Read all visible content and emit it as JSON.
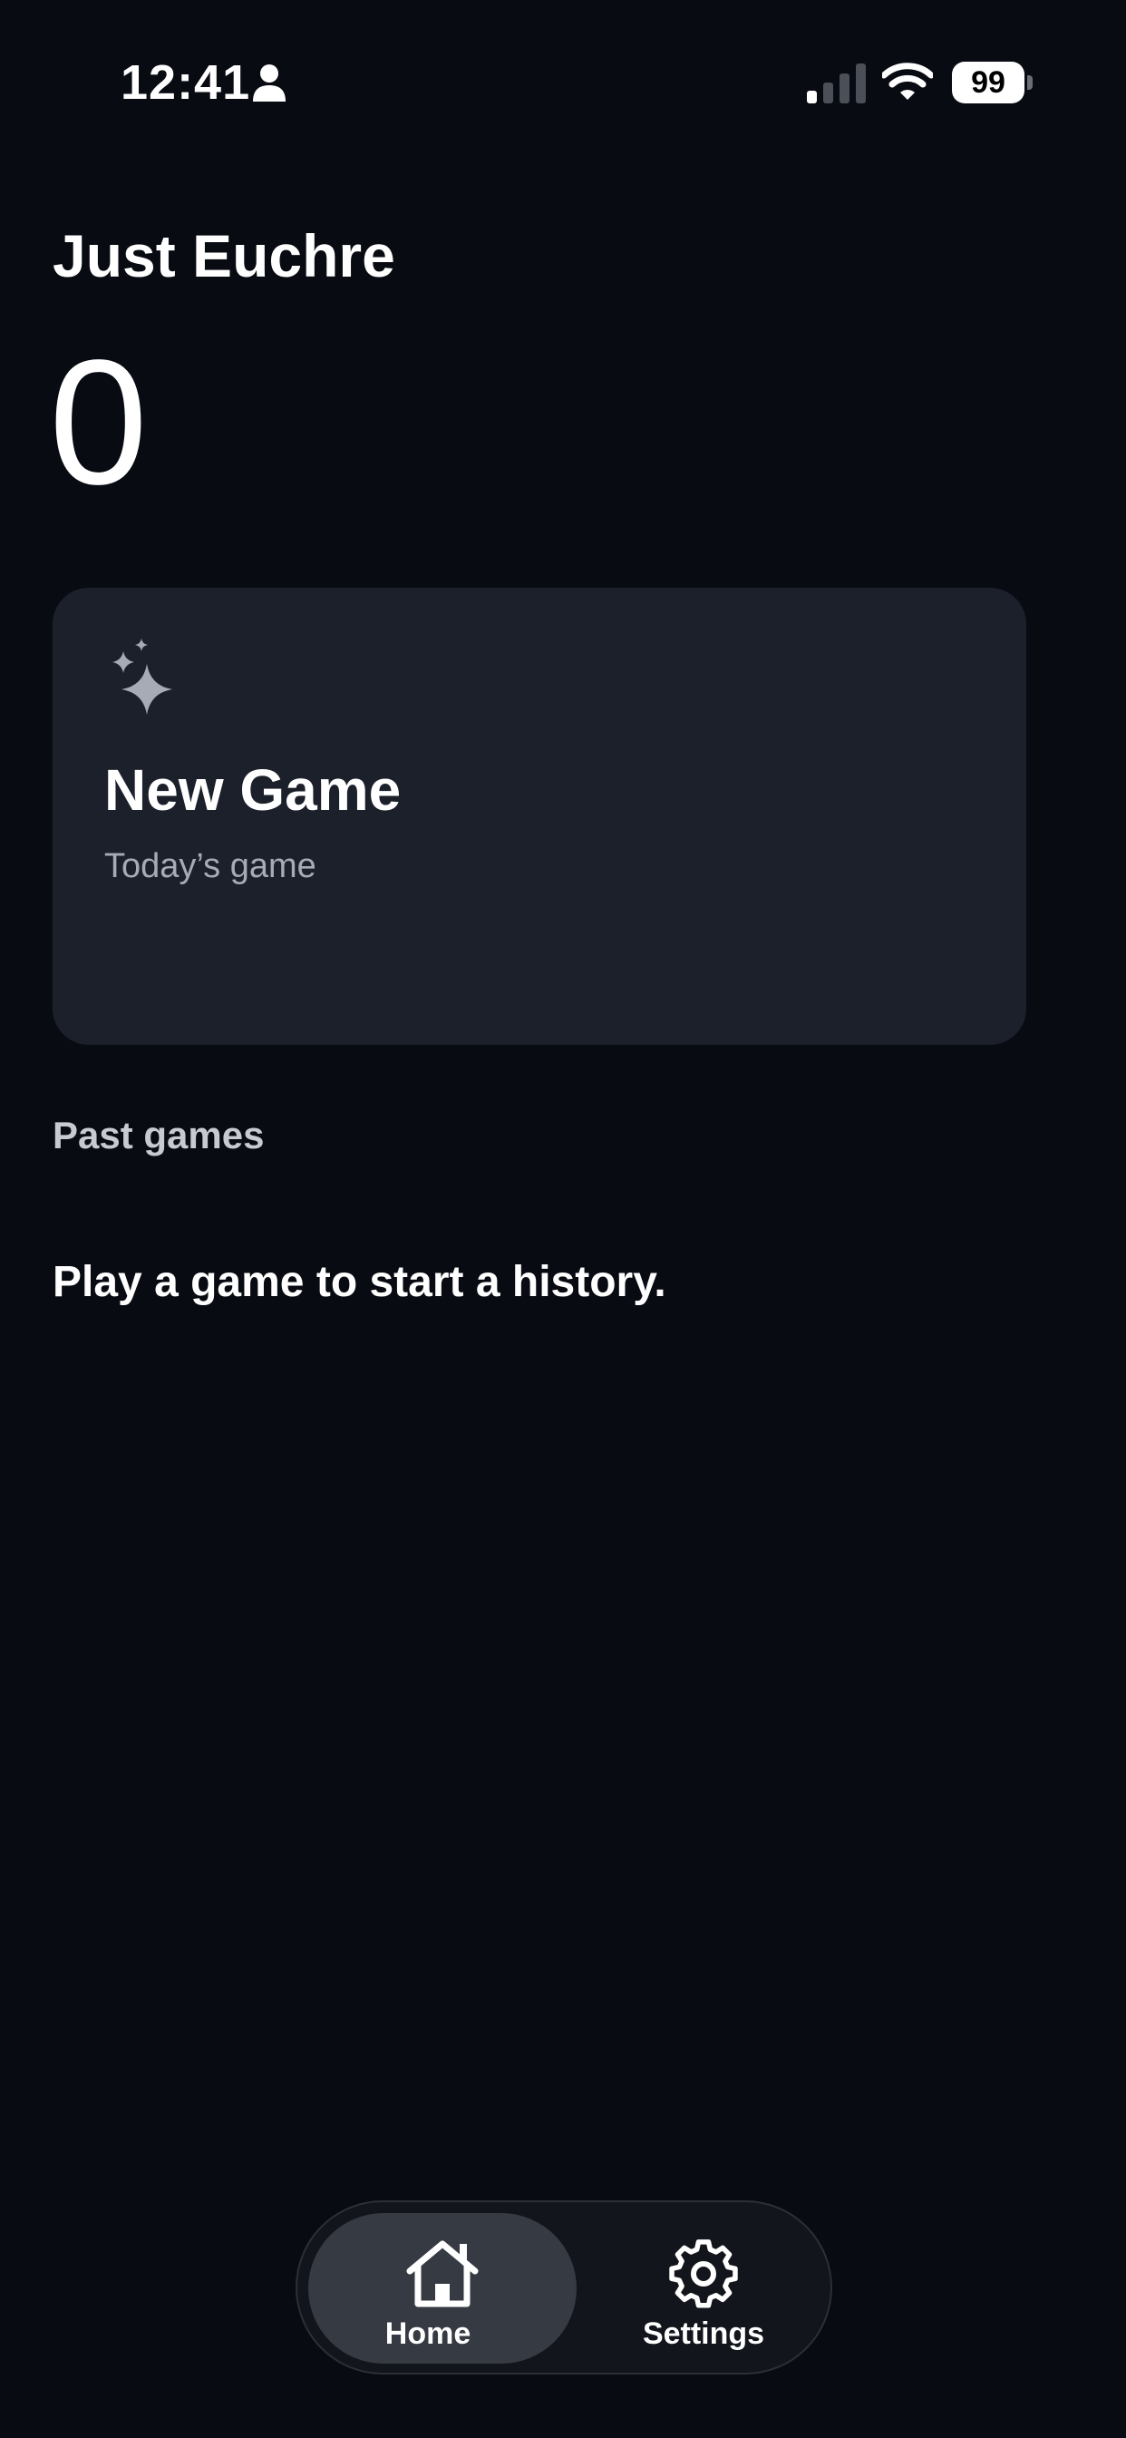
{
  "status_bar": {
    "time": "12:41",
    "battery_level": "99",
    "icons": [
      "person-icon",
      "signal-icon",
      "wifi-icon",
      "battery-icon"
    ]
  },
  "header": {
    "title": "Just Euchre",
    "score": "0"
  },
  "new_game_card": {
    "icon": "sparkles-icon",
    "title": "New Game",
    "subtitle": "Today’s game"
  },
  "past_games": {
    "header": "Past games",
    "empty_message": "Play a game to start a history."
  },
  "tab_bar": {
    "tabs": [
      {
        "label": "Home",
        "icon": "house-icon",
        "selected": true
      },
      {
        "label": "Settings",
        "icon": "gear-icon",
        "selected": false
      }
    ]
  },
  "colors": {
    "background": "#080b12",
    "card": "#1b202b",
    "tab_bar": "#12151c",
    "tab_selected": "#363a42",
    "secondary_text": "#a6abb5"
  }
}
